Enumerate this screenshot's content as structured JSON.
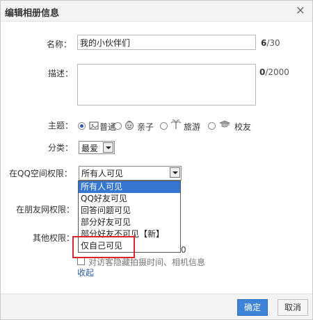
{
  "dialog": {
    "title": "编辑相册信息",
    "close_icon": "×"
  },
  "form": {
    "name_label": "名称：",
    "name_value": "我的小伙伴们",
    "name_count": "6",
    "name_max": "/30",
    "desc_label": "描述：",
    "desc_count": "0",
    "desc_max": "/2000",
    "theme_label": "主题：",
    "themes": [
      {
        "label": "普通",
        "icon": "album-icon",
        "checked": true
      },
      {
        "label": "亲子",
        "icon": "child-face-icon",
        "checked": false
      },
      {
        "label": "旅游",
        "icon": "palm-tree-icon",
        "checked": false
      },
      {
        "label": "校友",
        "icon": "graduation-cap-icon",
        "checked": false
      }
    ],
    "category_label": "分类：",
    "category_value": "最爱",
    "qq_perm_label": "在QQ空间权限：",
    "qq_perm_value": "所有人可见",
    "friend_perm_label": "在朋友网权限：",
    "other_perm_label": "其他权限：",
    "partial_hidden_suffix": "0",
    "visitor_hide_label": "对访客隐藏拍摄时间、相机信息",
    "collapse_link": "收起"
  },
  "dropdown": {
    "options": [
      "所有人可见",
      "QQ好友可见",
      "回答问题可见",
      "部分好友可见",
      "部分好友不可见【新】",
      "仅自己可见"
    ],
    "selected_index": 0
  },
  "footer": {
    "ok_label": "确定",
    "cancel_label": "取消"
  },
  "colors": {
    "accent": "#3d83d8",
    "selected_option": "#3476d2",
    "highlight": "#d9262e"
  }
}
